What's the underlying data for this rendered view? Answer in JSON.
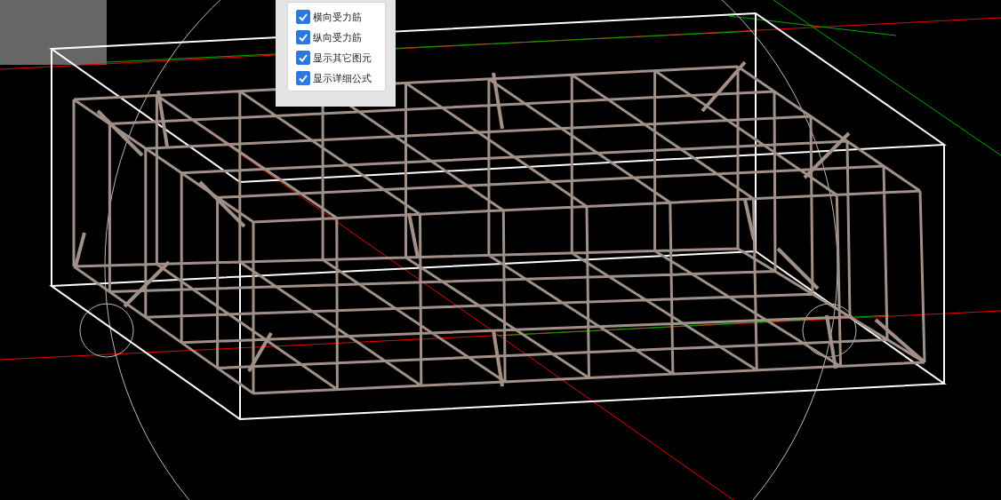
{
  "options": [
    {
      "label": "横向受力筋",
      "checked": true
    },
    {
      "label": "纵向受力筋",
      "checked": true
    },
    {
      "label": "显示其它图元",
      "checked": true
    },
    {
      "label": "显示详细公式",
      "checked": true
    }
  ]
}
